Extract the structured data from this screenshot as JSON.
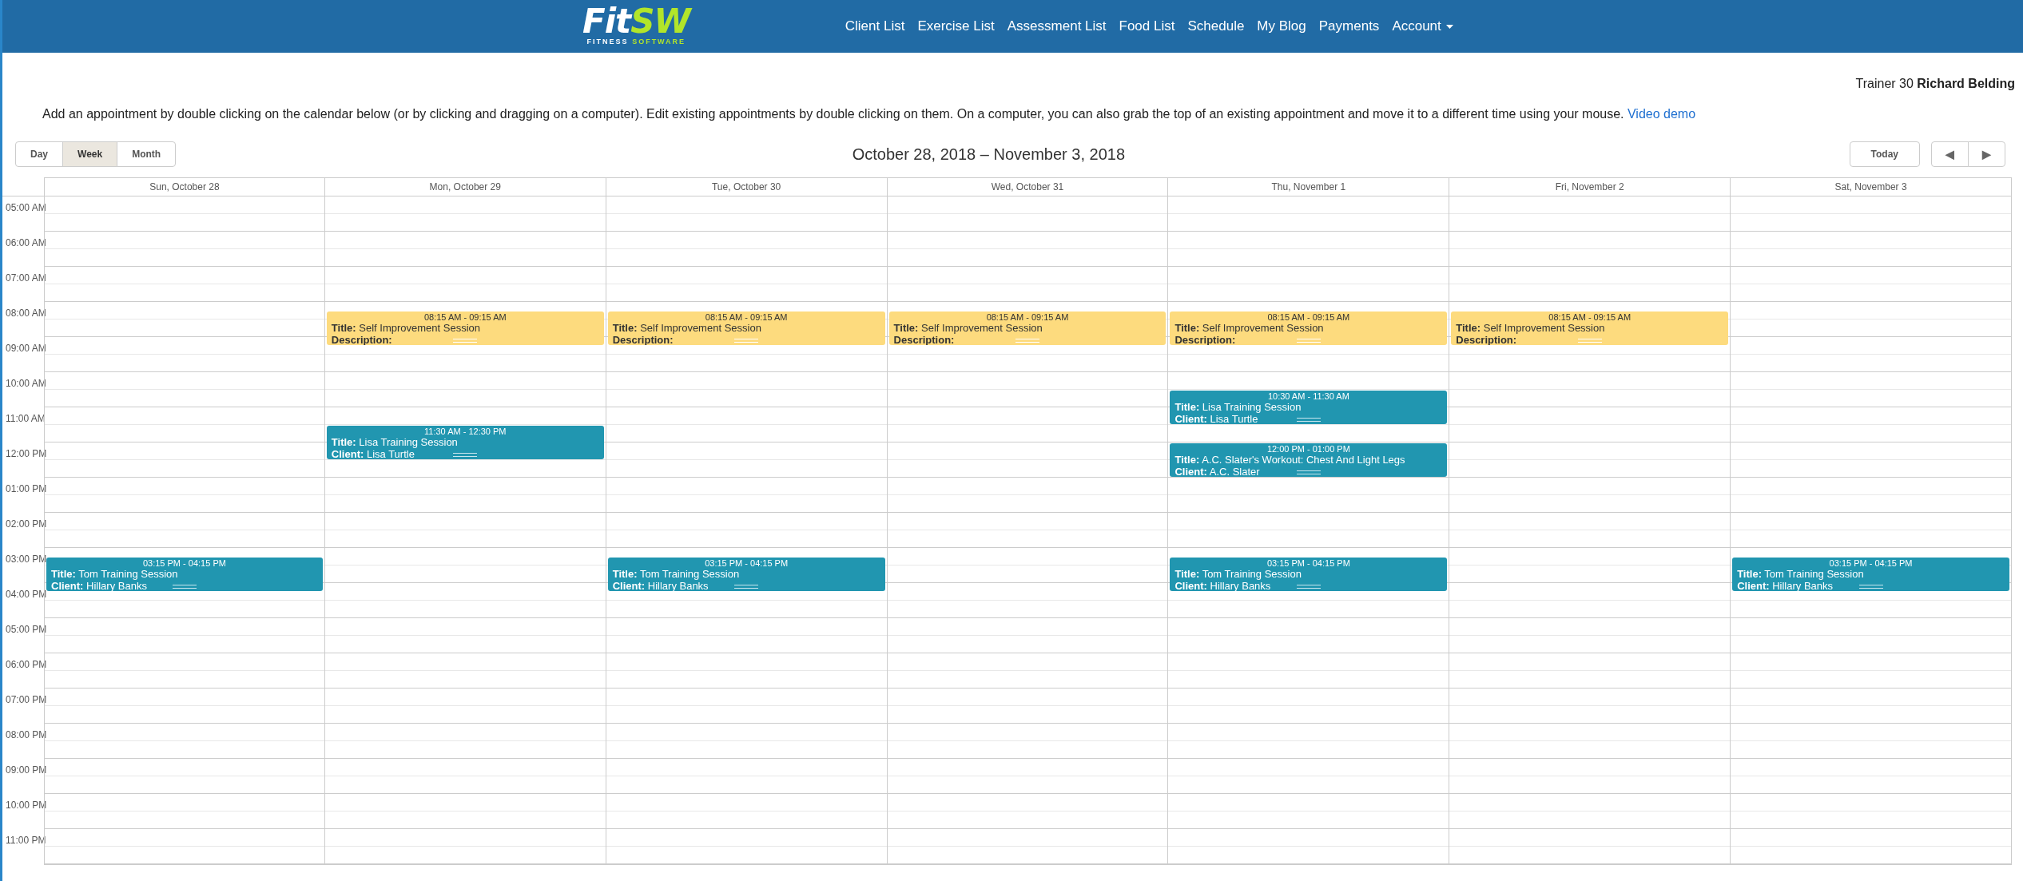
{
  "navbar": {
    "logo": {
      "text_1": "Fit",
      "text_2": "SW",
      "tagline_1": "FITNESS",
      "tagline_2": "SOFTWARE"
    },
    "links": [
      {
        "label": "Client List"
      },
      {
        "label": "Exercise List"
      },
      {
        "label": "Assessment List"
      },
      {
        "label": "Food List"
      },
      {
        "label": "Schedule"
      },
      {
        "label": "My Blog"
      },
      {
        "label": "Payments"
      },
      {
        "label": "Account",
        "kind": "dropdown"
      }
    ]
  },
  "user": {
    "prefix": "Trainer 30",
    "name": "Richard Belding"
  },
  "instructions": {
    "text": "Add an appointment by double clicking on the calendar below (or by clicking and dragging on a computer). Edit existing appointments by double clicking on them. On a computer, you can also grab the top of an existing appointment and move it to a different time using your mouse.",
    "link": "Video demo"
  },
  "toolbar": {
    "views": [
      {
        "label": "Day",
        "selected": false
      },
      {
        "label": "Week",
        "selected": true
      },
      {
        "label": "Month",
        "selected": false
      }
    ],
    "title": "October 28, 2018 – November 3, 2018",
    "today": "Today",
    "prev": "◀",
    "next": "▶"
  },
  "calendar": {
    "hours": [
      "05:00 AM",
      "06:00 AM",
      "07:00 AM",
      "08:00 AM",
      "09:00 AM",
      "10:00 AM",
      "11:00 AM",
      "12:00 PM",
      "01:00 PM",
      "02:00 PM",
      "03:00 PM",
      "04:00 PM",
      "05:00 PM",
      "06:00 PM",
      "07:00 PM",
      "08:00 PM",
      "09:00 PM",
      "10:00 PM",
      "11:00 PM"
    ],
    "days": [
      {
        "label": "Sun, October 28",
        "events": [
          {
            "time": "03:15 PM - 04:15 PM",
            "color": "#2196b0",
            "lines": [
              {
                "label": "Title:",
                "value": "Tom Training Session"
              },
              {
                "label": "Client:",
                "value": "Hillary Banks"
              }
            ]
          }
        ]
      },
      {
        "label": "Mon, October 29",
        "events": [
          {
            "time": "08:15 AM - 09:15 AM",
            "color": "#fddb7e",
            "lines": [
              {
                "label": "Title:",
                "value": "Self Improvement Session"
              },
              {
                "label": "Description:"
              }
            ]
          },
          {
            "time": "11:30 AM - 12:30 PM",
            "color": "#2196b0",
            "lines": [
              {
                "label": "Title:",
                "value": "Lisa Training Session"
              },
              {
                "label": "Client:",
                "value": "Lisa Turtle"
              }
            ]
          }
        ]
      },
      {
        "label": "Tue, October 30",
        "events": [
          {
            "time": "08:15 AM - 09:15 AM",
            "color": "#fddb7e",
            "lines": [
              {
                "label": "Title:",
                "value": "Self Improvement Session"
              },
              {
                "label": "Description:"
              }
            ]
          },
          {
            "time": "03:15 PM - 04:15 PM",
            "color": "#2196b0",
            "lines": [
              {
                "label": "Title:",
                "value": "Tom Training Session"
              },
              {
                "label": "Client:",
                "value": "Hillary Banks"
              }
            ]
          }
        ]
      },
      {
        "label": "Wed, October 31",
        "events": [
          {
            "time": "08:15 AM - 09:15 AM",
            "color": "#fddb7e",
            "lines": [
              {
                "label": "Title:",
                "value": "Self Improvement Session"
              },
              {
                "label": "Description:"
              }
            ]
          }
        ]
      },
      {
        "label": "Thu, November 1",
        "events": [
          {
            "time": "08:15 AM - 09:15 AM",
            "color": "#fddb7e",
            "lines": [
              {
                "label": "Title:",
                "value": "Self Improvement Session"
              },
              {
                "label": "Description:"
              }
            ]
          },
          {
            "time": "10:30 AM - 11:30 AM",
            "color": "#2196b0",
            "lines": [
              {
                "label": "Title:",
                "value": "Lisa Training Session"
              },
              {
                "label": "Client:",
                "value": "Lisa Turtle"
              }
            ]
          },
          {
            "time": "12:00 PM - 01:00 PM",
            "color": "#2196b0",
            "lines": [
              {
                "label": "Title:",
                "value": "A.C. Slater's Workout: Chest And Light Legs"
              },
              {
                "label": "Client:",
                "value": "A.C. Slater"
              }
            ]
          },
          {
            "time": "03:15 PM - 04:15 PM",
            "color": "#2196b0",
            "lines": [
              {
                "label": "Title:",
                "value": "Tom Training Session"
              },
              {
                "label": "Client:",
                "value": "Hillary Banks"
              }
            ]
          }
        ]
      },
      {
        "label": "Fri, November 2",
        "events": [
          {
            "time": "08:15 AM - 09:15 AM",
            "color": "#fddb7e",
            "lines": [
              {
                "label": "Title:",
                "value": "Self Improvement Session"
              },
              {
                "label": "Description:"
              }
            ]
          }
        ]
      },
      {
        "label": "Sat, November 3",
        "events": [
          {
            "time": "03:15 PM - 04:15 PM",
            "color": "#2196b0",
            "lines": [
              {
                "label": "Title:",
                "value": "Tom Training Session"
              },
              {
                "label": "Client:",
                "value": "Hillary Banks"
              }
            ]
          }
        ]
      }
    ]
  }
}
